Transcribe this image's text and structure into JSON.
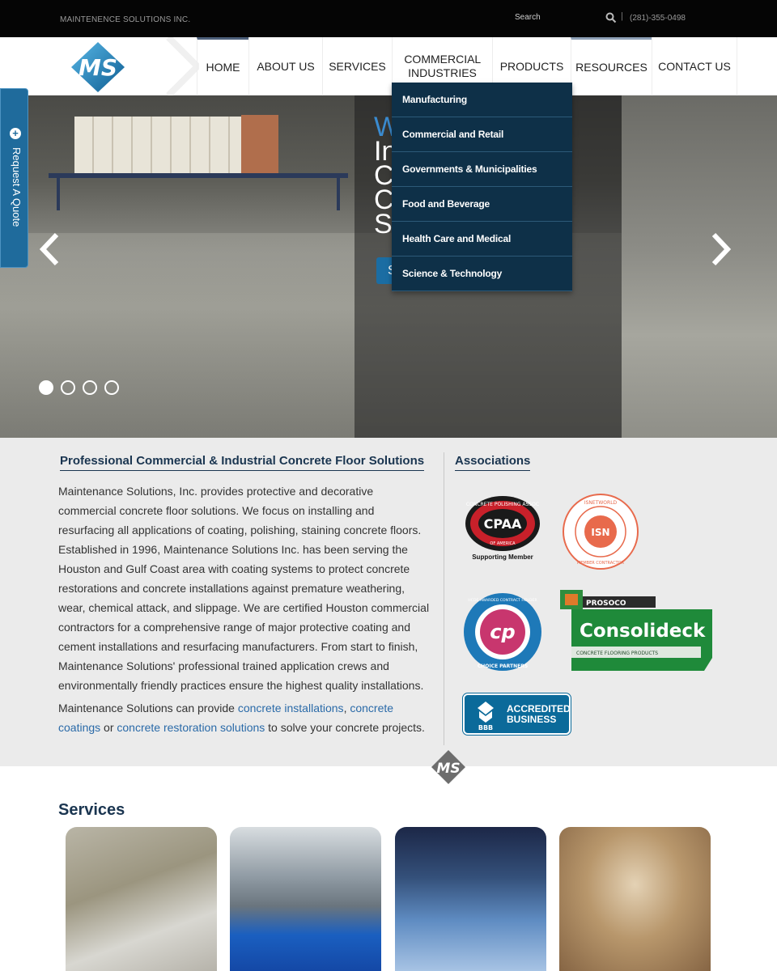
{
  "topbar": {
    "company": "MAINTENENCE SOLUTIONS INC.",
    "search_label": "Search",
    "search_icon": "search-icon",
    "separator": "|",
    "phone": "(281)-355-0498"
  },
  "nav": {
    "logo_text": "MS",
    "items": [
      {
        "label": "HOME"
      },
      {
        "label": "ABOUT US"
      },
      {
        "label": "SERVICES"
      },
      {
        "label": "COMMERCIAL INDUSTRIES"
      },
      {
        "label": "PRODUCTS"
      },
      {
        "label": "RESOURCES"
      },
      {
        "label": "CONTACT US"
      }
    ]
  },
  "dropdown": {
    "items": [
      {
        "label": "Manufacturing"
      },
      {
        "label": "Commercial and Retail"
      },
      {
        "label": "Governments & Municipalities"
      },
      {
        "label": "Food and Beverage"
      },
      {
        "label": "Health Care and Medical"
      },
      {
        "label": "Science & Technology"
      }
    ]
  },
  "hero": {
    "heading_partial_1": "W",
    "heading_partial_2": "In C C S",
    "cta_partial": "S",
    "slide_count": 4,
    "active_slide": 1
  },
  "quote_tab": {
    "label": "Request A Quote",
    "icon": "plus-circle-icon"
  },
  "intro": {
    "title": "Professional Commercial & Industrial Concrete Floor Solutions",
    "paragraph": "Maintenance Solutions, Inc. provides protective and decorative commercial concrete floor solutions. We focus on installing and resurfacing all applications of coating, polishing, staining concrete floors. Established in 1996, Maintenance Solutions Inc. has been serving the Houston and Gulf Coast area with coating systems to protect concrete restorations and concrete installations against premature weathering, wear, chemical attack, and slippage. We are certified Houston commercial contractors for a comprehensive range of major protective coating and cement installations and resurfacing manufacturers. From start to finish, Maintenance Solutions' professional trained application crews and environmentally friendly practices ensure the highest quality installations.",
    "p2_prefix": "Maintenance Solutions can provide ",
    "link1": "concrete installations",
    "p2_comma": ", ",
    "link2": "concrete coatings",
    "p2_or": " or ",
    "link3": "concrete restoration solutions",
    "p2_suffix": " to solve your concrete projects."
  },
  "associations": {
    "title": "Associations",
    "cpaa": {
      "top_text": "CONCRETE POLISHING ASSOC",
      "bottom_text": "OF AMERICA",
      "mark": "CPAA",
      "caption": "Supporting Member"
    },
    "isn": {
      "top_text": "ISNETWORLD",
      "bottom_text": "MEMBER CONTRACTOR",
      "mark": "ISN"
    },
    "hcde": {
      "top_text": "HCDE AWARDED CONTRACT HOLDER",
      "bottom_text": "CHOICE PARTNERS",
      "mark": "cp"
    },
    "consolideck": {
      "brand": "PROSOCO",
      "name": "Consolideck",
      "sub": "CONCRETE FLOORING PRODUCTS"
    },
    "bbb": {
      "line1": "ACCREDITED",
      "line2": "BUSINESS",
      "mark": "BBB"
    }
  },
  "services": {
    "title": "Services"
  },
  "colors": {
    "navy": "#0e3048",
    "accent_blue": "#1f6b9c",
    "link_blue": "#2a6aa8"
  }
}
